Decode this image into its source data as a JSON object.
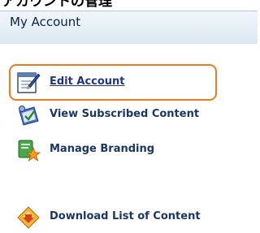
{
  "page_caption": "アカウントの管理",
  "panel": {
    "title": "My Account",
    "items": [
      {
        "label": "Edit Account",
        "icon": "edit-document-icon",
        "highlighted": true
      },
      {
        "label": "View Subscribed Content",
        "icon": "subscription-icon",
        "highlighted": false
      },
      {
        "label": "Manage Branding",
        "icon": "branding-icon",
        "highlighted": false
      },
      {
        "label": "Download List of Content",
        "icon": "download-icon",
        "highlighted": false
      }
    ]
  },
  "colors": {
    "highlight": "#ef7a1d",
    "header_bg": "#e6eef6",
    "link": "#20367a"
  }
}
